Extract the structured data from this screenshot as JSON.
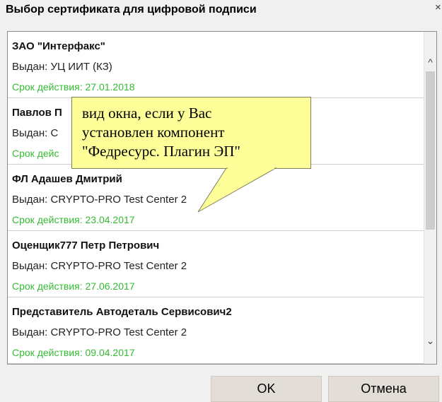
{
  "dialog": {
    "title": "Выбор сертификата для цифровой подписи",
    "close_label": "×"
  },
  "certificates": [
    {
      "name": "ЗАО \"Интерфакс\"",
      "issuer": "Выдан: УЦ ИИТ (КЗ)",
      "validity": "Срок действия: 27.01.2018"
    },
    {
      "name": "Павлов П",
      "issuer": "Выдан: C",
      "validity": "Срок дейс"
    },
    {
      "name": "ФЛ Адашев Дмитрий",
      "issuer": "Выдан: CRYPTO-PRO Test Center 2",
      "validity": "Срок действия: 23.04.2017"
    },
    {
      "name": "Оценщик777 Петр Петрович",
      "issuer": "Выдан: CRYPTO-PRO Test Center 2",
      "validity": "Срок действия: 27.06.2017"
    },
    {
      "name": "Представитель Автодеталь Сервисович2",
      "issuer": "Выдан: CRYPTO-PRO Test Center 2",
      "validity": "Срок действия: 09.04.2017"
    }
  ],
  "scrollbar": {
    "up_glyph": "^",
    "down_glyph": "⌄"
  },
  "buttons": {
    "ok": "OK",
    "cancel": "Отмена"
  },
  "callout": {
    "line1": "вид окна, если у Вас",
    "line2": "установлен компонент",
    "line3": "\"Федресурс. Плагин ЭП\""
  },
  "colors": {
    "validity_text": "#33bb33",
    "callout_bg": "#ffff99",
    "button_bg": "#e2ddd6"
  }
}
